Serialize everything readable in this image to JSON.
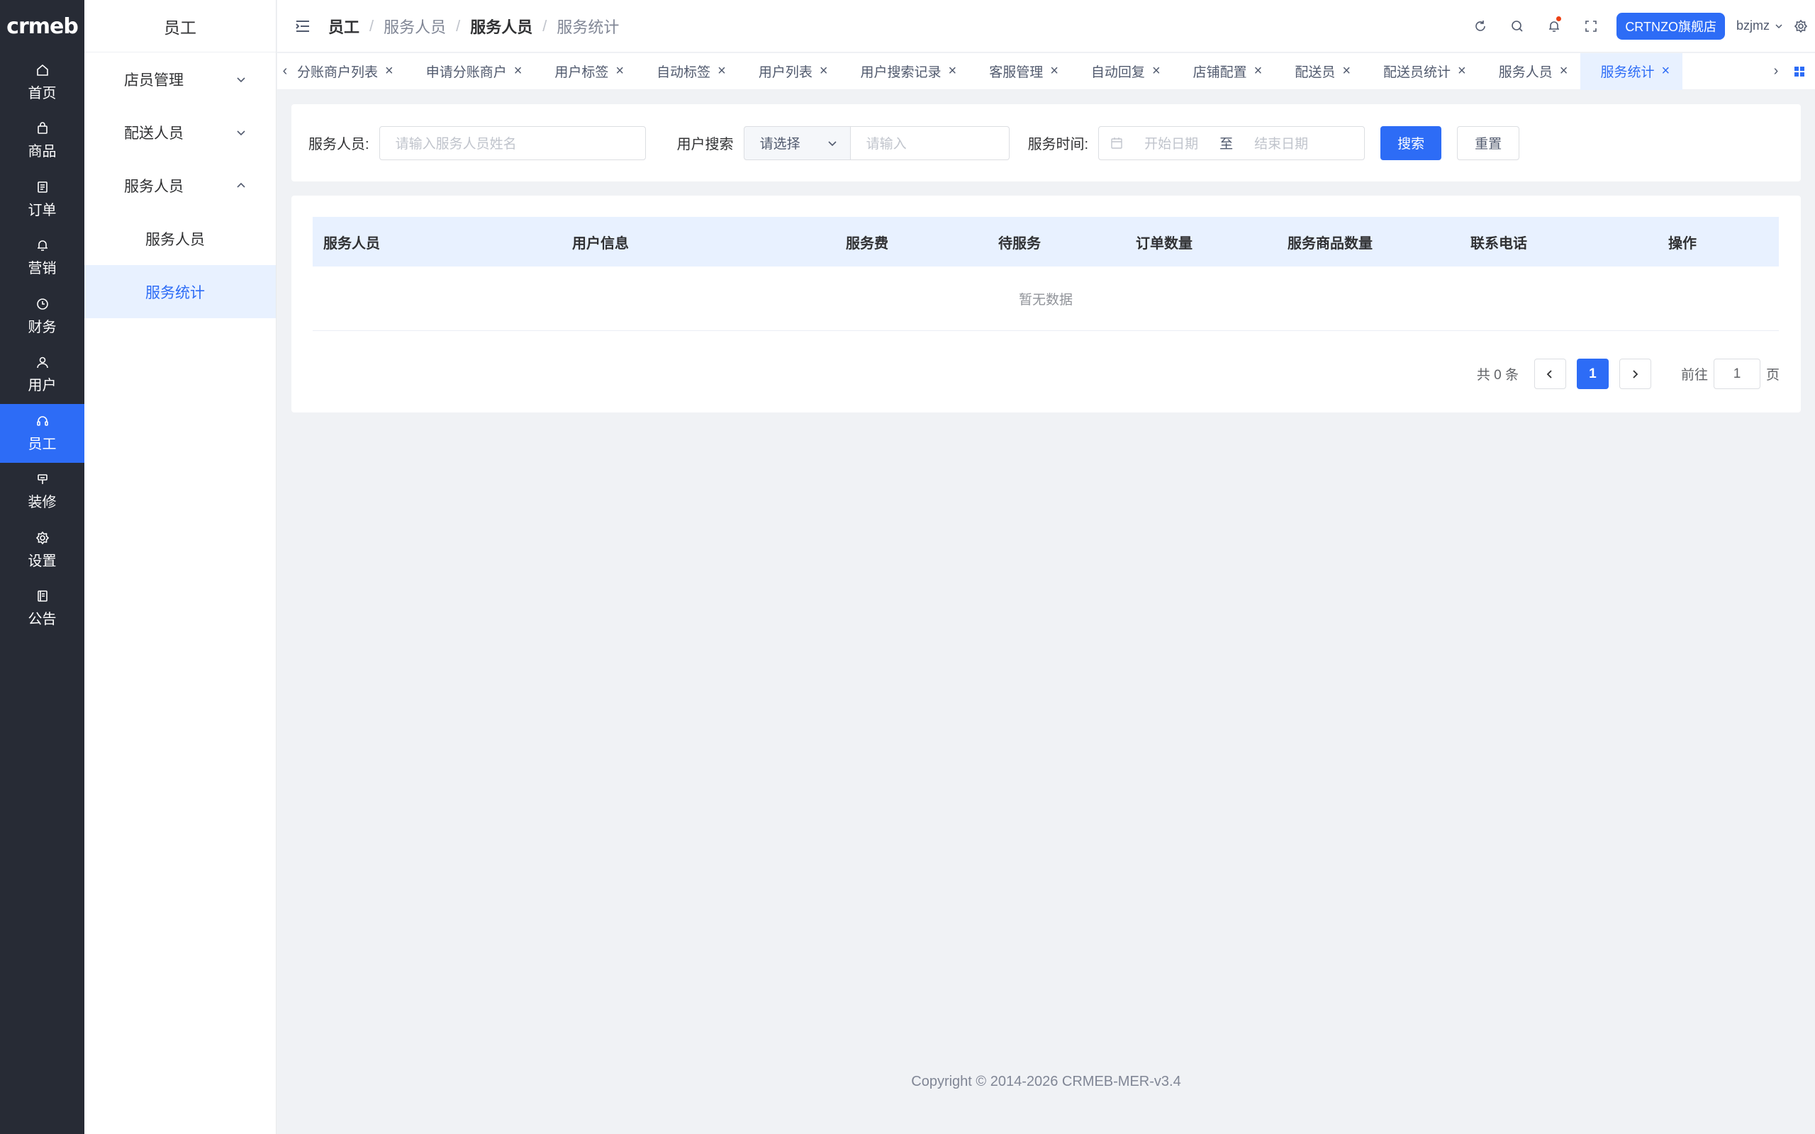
{
  "rail": {
    "logo": "crmeb",
    "items": [
      {
        "label": "首页",
        "icon": "home-icon"
      },
      {
        "label": "商品",
        "icon": "bag-icon"
      },
      {
        "label": "订单",
        "icon": "document-icon"
      },
      {
        "label": "营销",
        "icon": "bell-icon"
      },
      {
        "label": "财务",
        "icon": "clock-icon"
      },
      {
        "label": "用户",
        "icon": "user-icon"
      },
      {
        "label": "员工",
        "icon": "headset-icon",
        "active": true
      },
      {
        "label": "装修",
        "icon": "paint-icon"
      },
      {
        "label": "设置",
        "icon": "gear-icon"
      },
      {
        "label": "公告",
        "icon": "notice-icon"
      }
    ]
  },
  "subside": {
    "title": "员工",
    "groups": [
      {
        "label": "店员管理"
      },
      {
        "label": "配送人员"
      },
      {
        "label": "服务人员"
      }
    ],
    "items": [
      {
        "label": "服务人员"
      },
      {
        "label": "服务统计",
        "active": true
      }
    ]
  },
  "header": {
    "breadcrumb": [
      "员工",
      "服务人员",
      "服务人员",
      "服务统计"
    ],
    "store": "CRTNZO旗舰店",
    "user": "bzjmz"
  },
  "tabs": [
    {
      "label": "分账商户列表"
    },
    {
      "label": "申请分账商户"
    },
    {
      "label": "用户标签"
    },
    {
      "label": "自动标签"
    },
    {
      "label": "用户列表"
    },
    {
      "label": "用户搜索记录"
    },
    {
      "label": "客服管理"
    },
    {
      "label": "自动回复"
    },
    {
      "label": "店铺配置"
    },
    {
      "label": "配送员"
    },
    {
      "label": "配送员统计"
    },
    {
      "label": "服务人员"
    },
    {
      "label": "服务统计",
      "active": true
    }
  ],
  "search": {
    "staff_label": "服务人员:",
    "staff_placeholder": "请输入服务人员姓名",
    "user_label": "用户搜索",
    "user_select": "请选择",
    "user_placeholder": "请输入",
    "time_label": "服务时间:",
    "start_placeholder": "开始日期",
    "range_sep": "至",
    "end_placeholder": "结束日期",
    "search_btn": "搜索",
    "reset_btn": "重置"
  },
  "table": {
    "columns": [
      "服务人员",
      "用户信息",
      "服务费",
      "待服务",
      "订单数量",
      "服务商品数量",
      "联系电话",
      "操作"
    ],
    "empty_text": "暂无数据"
  },
  "pager": {
    "total": "共 0 条",
    "page": "1",
    "goto_label": "前往",
    "goto_value": "1",
    "goto_suffix": "页"
  },
  "footer": "Copyright © 2014-2026 CRMEB-MER-v3.4",
  "colors": {
    "primary": "#2d6cf6",
    "rail": "#272b35",
    "active_bg": "#e8f1ff"
  }
}
